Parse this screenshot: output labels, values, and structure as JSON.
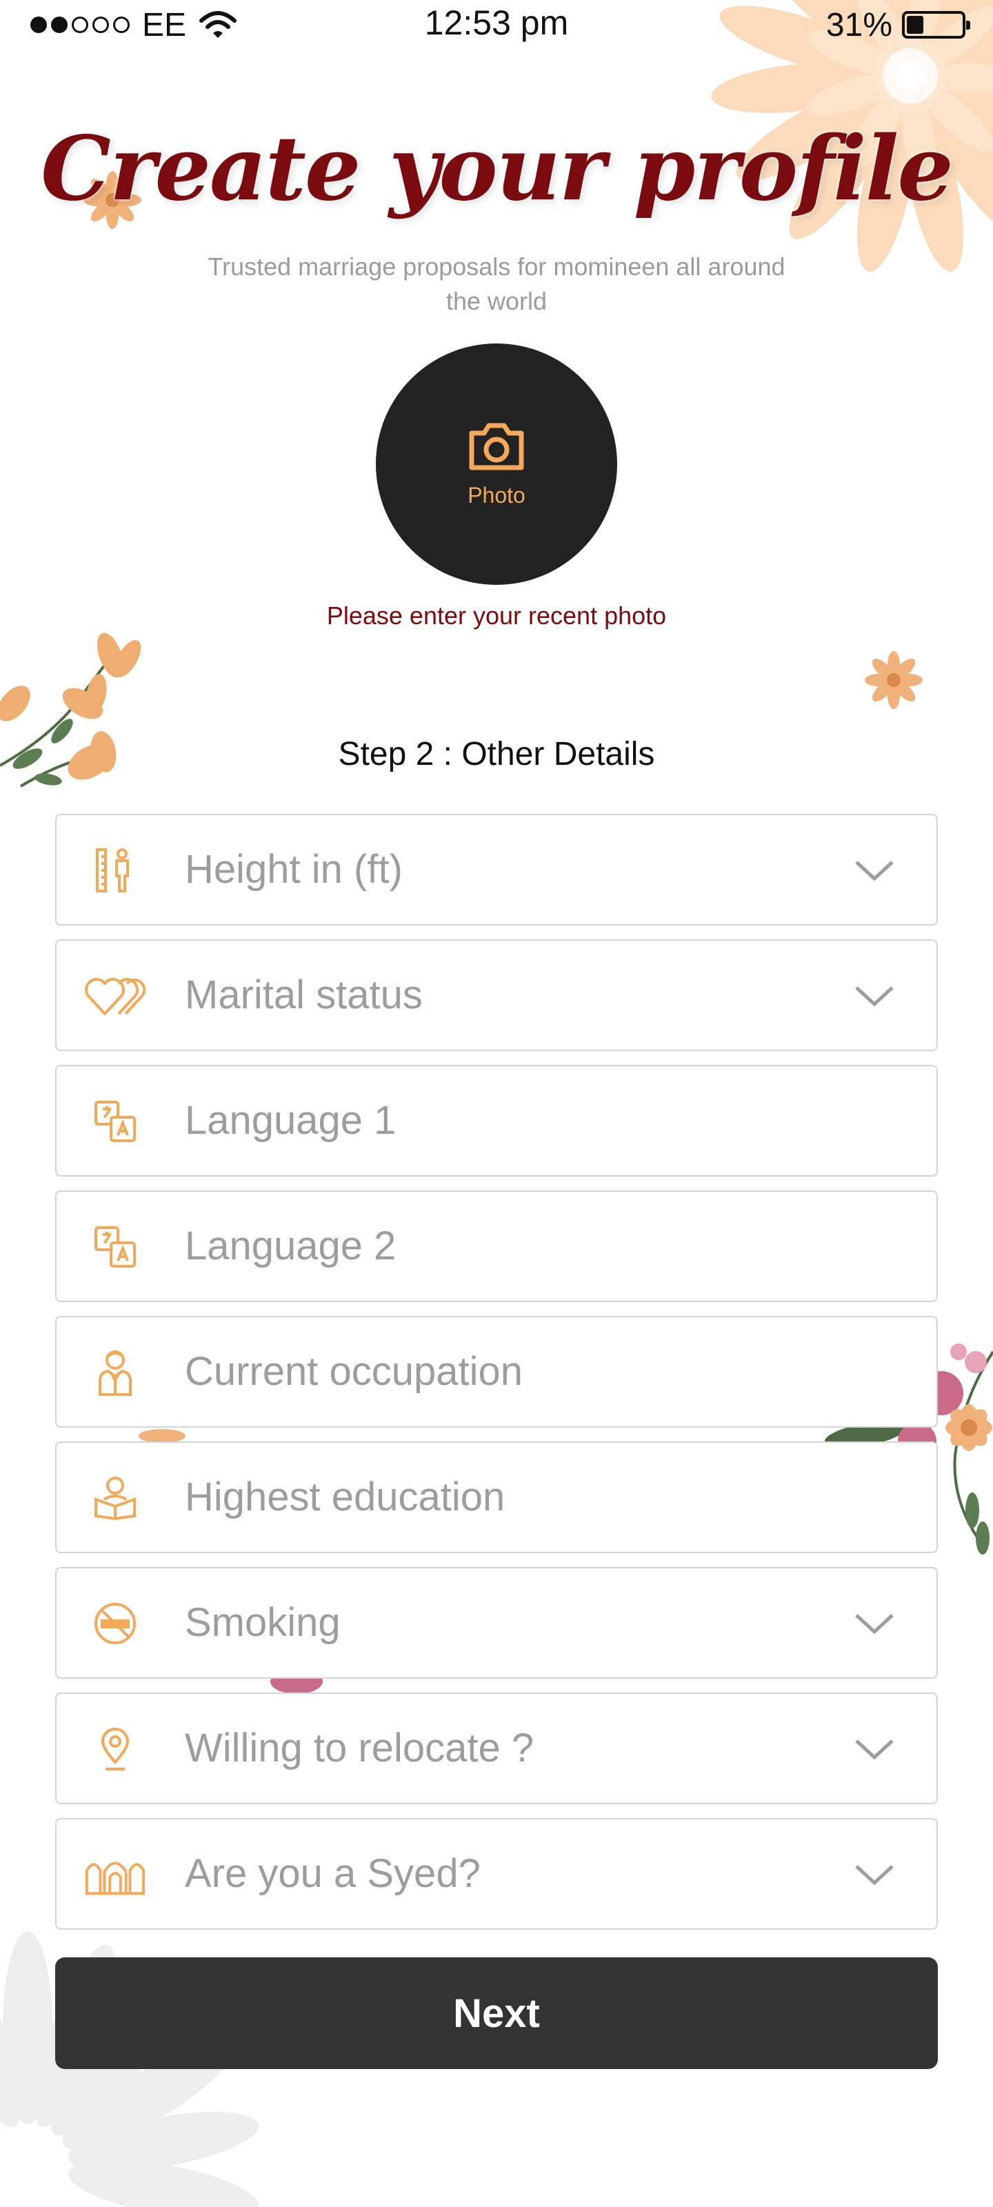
{
  "status_bar": {
    "carrier": "EE",
    "time": "12:53 pm",
    "battery": "31%",
    "battery_level": 0.31,
    "signal_bars_filled": 2,
    "signal_bars_total": 5
  },
  "header": {
    "title": "Create your profile",
    "subtitle": "Trusted marriage proposals for momineen all around the world"
  },
  "photo": {
    "label": "Photo",
    "hint": "Please enter your recent photo",
    "icon": "camera-icon"
  },
  "step_title": "Step 2 : Other Details",
  "fields": [
    {
      "label": "Height in (ft)",
      "icon": "height-icon",
      "dropdown": true
    },
    {
      "label": "Marital status",
      "icon": "hearts-icon",
      "dropdown": true
    },
    {
      "label": "Language 1",
      "icon": "translate-icon",
      "dropdown": false
    },
    {
      "label": "Language 2",
      "icon": "translate-icon",
      "dropdown": false
    },
    {
      "label": "Current occupation",
      "icon": "occupation-icon",
      "dropdown": false
    },
    {
      "label": "Highest education",
      "icon": "education-icon",
      "dropdown": false
    },
    {
      "label": "Smoking",
      "icon": "no-smoking-icon",
      "dropdown": true
    },
    {
      "label": "Willing to relocate ?",
      "icon": "location-pin-icon",
      "dropdown": true
    },
    {
      "label": "Are you a Syed?",
      "icon": "shrine-icon",
      "dropdown": true
    }
  ],
  "next_button": "Next",
  "colors": {
    "accent_orange": "#f2a959",
    "title_maroon": "#7a0c10",
    "photo_circle": "#222222",
    "button_bg": "#333333",
    "placeholder_gray": "#9d9d9d",
    "field_border": "#d4d4d4"
  }
}
